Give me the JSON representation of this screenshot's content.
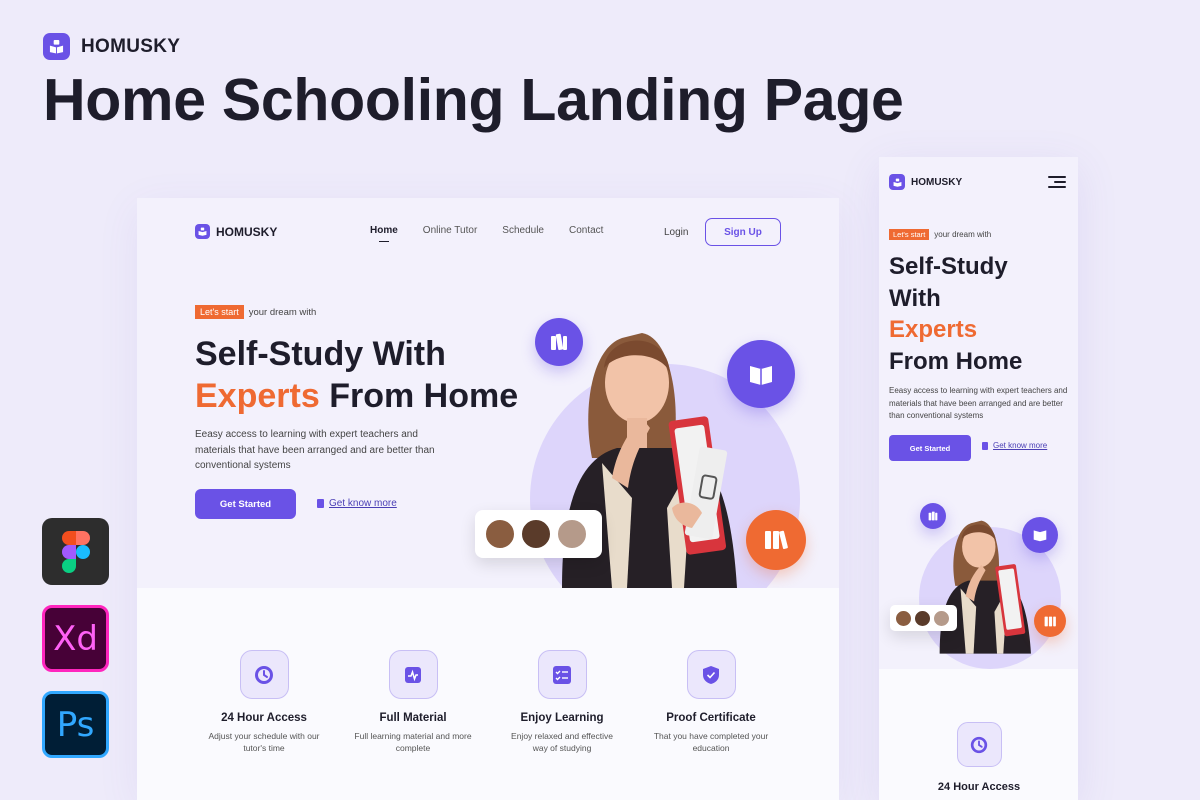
{
  "brand": {
    "name": "HOMUSKY",
    "title": "Home Schooling Landing Page"
  },
  "tools": [
    "figma-icon",
    "Xd",
    "Ps"
  ],
  "nav": {
    "logo": "HOMUSKY",
    "items": [
      "Home",
      "Online Tutor",
      "Schedule",
      "Contact"
    ],
    "login": "Login",
    "signup": "Sign Up"
  },
  "hero": {
    "tag": "Let's start",
    "tag_rest": "your dream with",
    "title_line1": "Self-Study With",
    "title_highlight": "Experts",
    "title_end": "From Home",
    "mobile_line1": "Self-Study",
    "mobile_line2": "With",
    "description": "Eeasy access to learning with expert teachers and materials that have been arranged and are better than conventional systems",
    "cta_primary": "Get Started",
    "cta_secondary": "Get know more"
  },
  "features": [
    {
      "icon": "clock-icon",
      "title": "24 Hour Access",
      "desc": "Adjust your schedule with our tutor's time"
    },
    {
      "icon": "chart-book-icon",
      "title": "Full Material",
      "desc": "Full learning material and more complete"
    },
    {
      "icon": "checklist-icon",
      "title": "Enjoy Learning",
      "desc": "Enjoy relaxed and effective way of studying"
    },
    {
      "icon": "shield-check-icon",
      "title": "Proof Certificate",
      "desc": "That you have completed your education"
    }
  ],
  "colors": {
    "accent": "#6a52e6",
    "highlight": "#ef6a32",
    "background": "#eeebfa",
    "text": "#1e1d2b"
  }
}
